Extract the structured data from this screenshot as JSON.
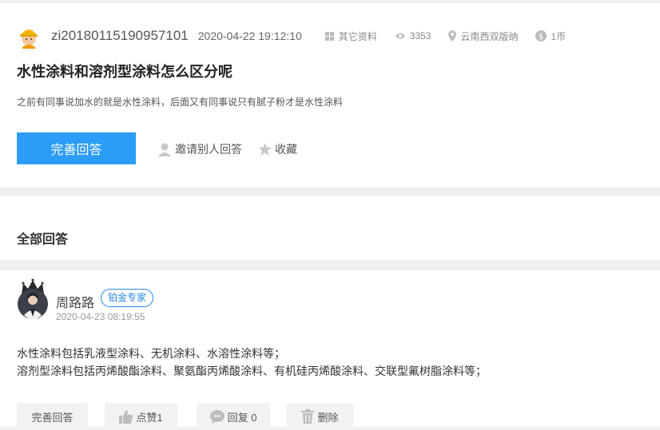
{
  "question": {
    "username": "zi20180115190957101",
    "datetime": "2020-04-22 19:12:10",
    "category": "其它资料",
    "views": "3353",
    "location": "云南西双版纳",
    "reward": "1币",
    "title": "水性涂料和溶剂型涂料怎么区分呢",
    "description": "之前有同事说加水的就是水性涂料，后面又有同事说只有腻子粉才是水性涂料",
    "answer_button": "完善回答",
    "invite_label": "邀请别人回答",
    "favorite_label": "收藏"
  },
  "answers_section": {
    "title": "全部回答"
  },
  "answer": {
    "name": "周路路",
    "badge": "铂金专家",
    "time": "2020-04-23 08:19:55",
    "line1": "水性涂料包括乳液型涂料、无机涂料、水溶性涂料等；",
    "line2": "溶剂型涂料包括丙烯酸酯涂料、聚氨酯丙烯酸涂料、有机硅丙烯酸涂料、交联型氟树脂涂料等；",
    "improve_label": "完善回答",
    "like_label": "点赞1",
    "reply_label": "回复 0",
    "delete_label": "删除"
  },
  "colors": {
    "accent": "#2b9cf7",
    "badge": "#2b86e8",
    "background": "#f0f0f0"
  },
  "icons": [
    "worker-avatar-icon",
    "category-icon",
    "eye-icon",
    "location-pin-icon",
    "coin-icon",
    "invite-user-icon",
    "star-icon",
    "crown-icon",
    "thumbs-up-icon",
    "comment-icon",
    "trash-icon"
  ]
}
